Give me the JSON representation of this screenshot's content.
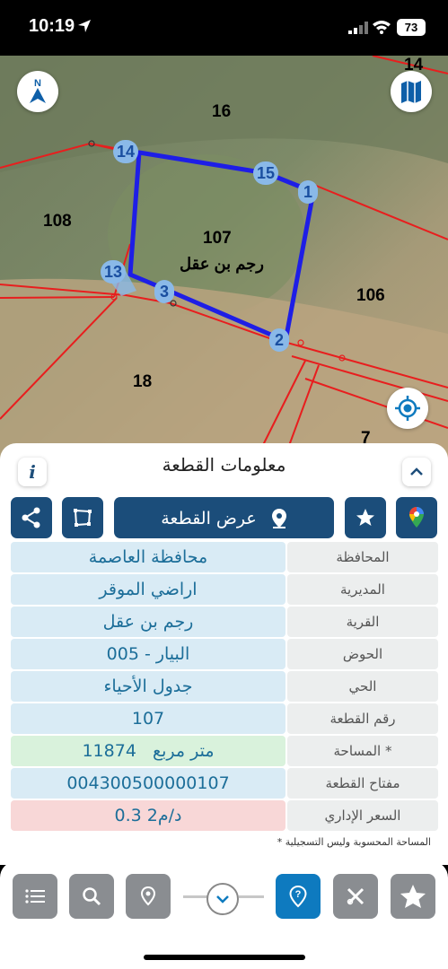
{
  "status_bar": {
    "time": "10:19",
    "battery": "73"
  },
  "map": {
    "parcel_labels": {
      "p14": "14",
      "p16": "16",
      "p108": "108",
      "p107": "107",
      "p106": "106",
      "p18": "18",
      "p7": "7"
    },
    "parcel_name": "رجم بن عقل",
    "vertices": {
      "v14": "14",
      "v15": "15",
      "v1": "1",
      "v13": "13",
      "v3": "3",
      "v2": "2"
    },
    "colors": {
      "boundary": "#1e1ee6",
      "parcel_lines": "#e81e1e",
      "vertex_bg": "#8ab9e8"
    }
  },
  "sheet": {
    "title": "معلومات القطعة",
    "info_label": "i",
    "view_parcel_label": "عرض القطعة",
    "rows": [
      {
        "key": "المحافظة",
        "value": "محافظة العاصمة"
      },
      {
        "key": "المديرية",
        "value": "اراضي الموقر"
      },
      {
        "key": "القرية",
        "value": "رجم بن عقل"
      },
      {
        "key": "الحوض",
        "value": "البيار - 005"
      },
      {
        "key": "الحي",
        "value": "جدول الأحياء"
      },
      {
        "key": "رقم القطعة",
        "value": "107"
      },
      {
        "key": "المساحة *",
        "value": "11874   متر مربع"
      },
      {
        "key": "مفتاح القطعة",
        "value": "004300500000107"
      },
      {
        "key": "السعر الإداري",
        "value": "0.3 د/م2"
      }
    ],
    "note": "* المساحة المحسوبة وليس التسجيلية"
  },
  "colors": {
    "primary": "#1b4d7a",
    "accent_blue": "#0e7abf",
    "value_text": "#1c6e99"
  }
}
